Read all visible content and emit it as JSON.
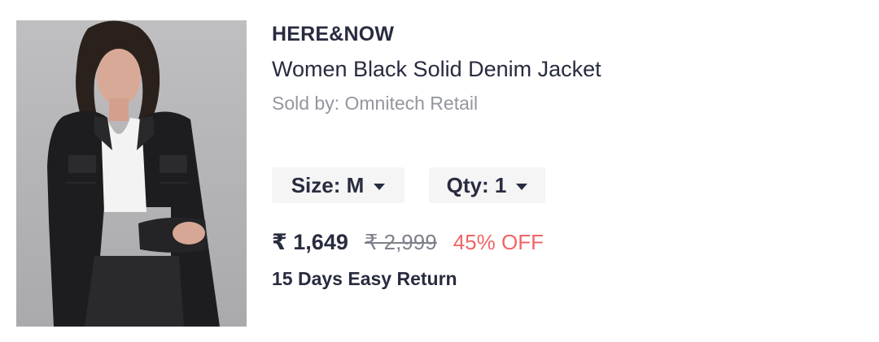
{
  "product": {
    "brand": "HERE&NOW",
    "name": "Women Black Solid Denim Jacket",
    "seller": "Sold by: Omnitech Retail",
    "image_alt": "woman-in-black-denim-jacket-photo"
  },
  "selectors": {
    "size_label": "Size: M",
    "qty_label": "Qty: 1"
  },
  "pricing": {
    "price": "₹ 1,649",
    "mrp": "₹ 2,999",
    "discount": "45% OFF"
  },
  "returns": {
    "policy": "15 Days Easy Return"
  },
  "colors": {
    "text_primary": "#282c3f",
    "text_secondary": "#94969f",
    "discount": "#f16565",
    "selector_bg": "#f5f5f6"
  }
}
